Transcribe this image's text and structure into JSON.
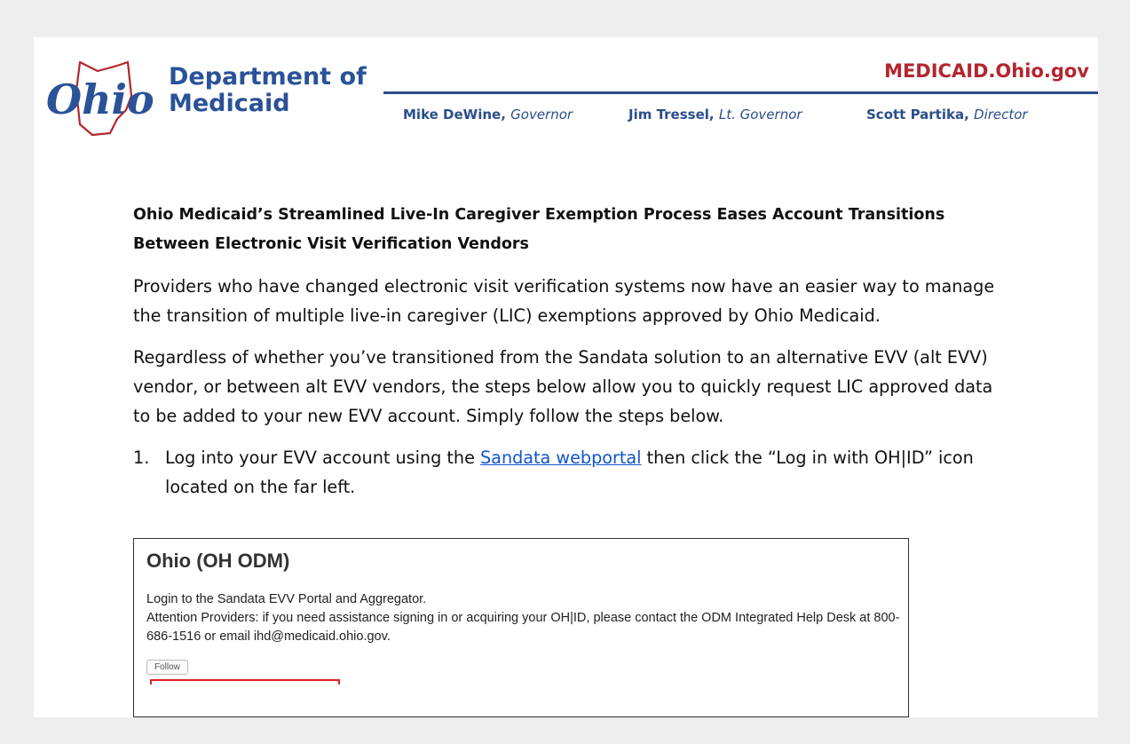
{
  "header": {
    "logo_script": "Ohio",
    "department_line1": "Department of",
    "department_line2": "Medicaid",
    "site": "MEDICAID.Ohio.gov",
    "officials": [
      {
        "name": "Mike DeWine,",
        "role": "Governor"
      },
      {
        "name": "Jim Tressel,",
        "role": "Lt. Governor"
      },
      {
        "name": "Scott Partika,",
        "role": "Director"
      }
    ],
    "colors": {
      "brand_blue": "#2a5298",
      "brand_red": "#b3262f"
    }
  },
  "article": {
    "headline": "Ohio Medicaid’s Streamlined Live-In Caregiver Exemption Process Eases Account Transitions Between Electronic Visit Verification Vendors",
    "paragraphs": [
      "Providers who have changed electronic visit verification systems now have an easier way to manage the transition of multiple live-in caregiver (LIC) exemptions approved by Ohio Medicaid.",
      "Regardless of whether you’ve transitioned from the Sandata solution to an alternative EVV (alt EVV) vendor, or between alt EVV vendors, the steps below allow you to quickly request LIC approved data to be added to your new  EVV account. Simply follow the steps below."
    ],
    "step1": {
      "number": "1.",
      "before": "Log into your EVV account using the ",
      "link": "Sandata webportal",
      "after": " then click the “Log in with OH|ID” icon located on the far left."
    }
  },
  "screenshot": {
    "title": "Ohio (OH ODM)",
    "line1": "Login to the Sandata EVV Portal and Aggregator.",
    "line2": "Attention Providers: if you need assistance signing in or acquiring your OH|ID, please contact the ODM Integrated Help Desk at 800-686-1516 or email ihd@medicaid.ohio.gov.",
    "follow_button": "Follow"
  }
}
